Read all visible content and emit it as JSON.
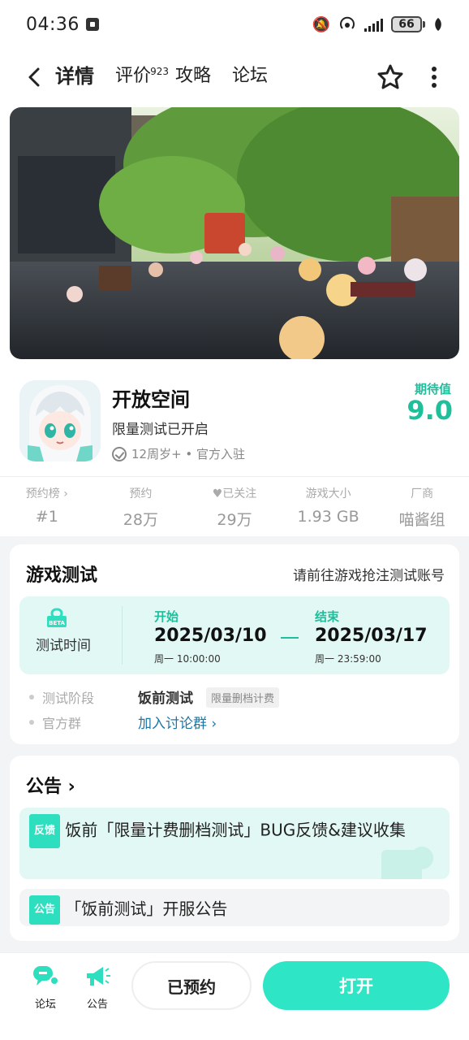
{
  "status_bar": {
    "time": "04:36",
    "battery": "66"
  },
  "nav": {
    "tabs": [
      {
        "label": "详情"
      },
      {
        "label": "评价",
        "badge": "923"
      },
      {
        "label": "攻略"
      },
      {
        "label": "论坛"
      }
    ]
  },
  "app": {
    "name": "开放空间",
    "subtitle": "限量测试已开启",
    "meta": "12周岁+ • 官方入驻",
    "expect_label": "期待值",
    "expect_score": "9.0"
  },
  "stats": [
    {
      "label": "预约榜 ›",
      "value": "#1"
    },
    {
      "label": "预约",
      "value": "28万"
    },
    {
      "label": "♥已关注",
      "value": "29万"
    },
    {
      "label": "游戏大小",
      "value": "1.93 GB"
    },
    {
      "label": "厂商",
      "value": "喵酱组"
    }
  ],
  "test": {
    "title": "游戏测试",
    "link": "请前往游戏抢注测试账号",
    "time_label": "测试时间",
    "start_label": "开始",
    "start_date": "2025/03/10",
    "start_sub": "周一  10:00:00",
    "end_label": "结束",
    "end_date": "2025/03/17",
    "end_sub": "周一  23:59:00",
    "stage_label": "测试阶段",
    "stage_value": "饭前测试",
    "stage_tag": "限量删档计费",
    "group_label": "官方群",
    "group_value": "加入讨论群 ›"
  },
  "notices": {
    "title": "公告 ›",
    "items": [
      {
        "tag": "反馈",
        "text": "饭前「限量计费删档测试」BUG反馈&建议收集"
      },
      {
        "tag": "公告",
        "text": "「饭前测试」开服公告"
      }
    ]
  },
  "bottom": {
    "forum_label": "论坛",
    "notice_label": "公告",
    "reserved_label": "已预约",
    "open_label": "打开"
  },
  "colors": {
    "accent": "#2ee6c6",
    "accent_text": "#1fbf9c",
    "link": "#1d77a8"
  }
}
